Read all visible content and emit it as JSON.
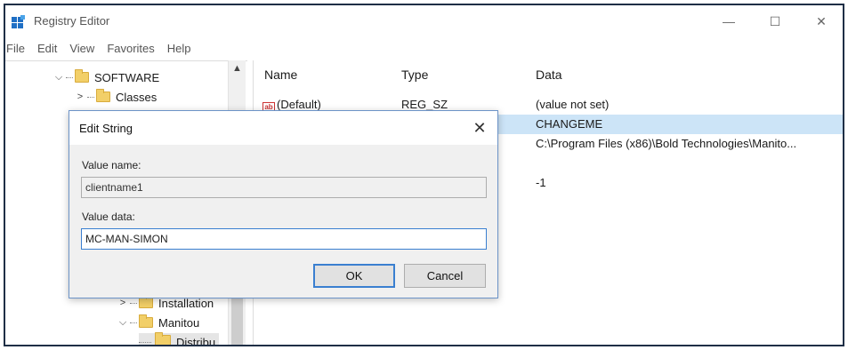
{
  "window": {
    "title": "Registry Editor",
    "controls": {
      "minimize": "—",
      "maximize": "☐",
      "close": "✕"
    }
  },
  "menu": [
    "File",
    "Edit",
    "View",
    "Favorites",
    "Help"
  ],
  "tree": {
    "visible_nodes": [
      {
        "label": "SOFTWARE",
        "expander": "⌵"
      },
      {
        "label": "Classes",
        "expander": ">"
      },
      {
        "label": "Installation",
        "expander": ">"
      },
      {
        "label": "Manitou",
        "expander": "⌵"
      },
      {
        "label": "Distribu",
        "expander": ""
      }
    ],
    "scroll_up": "▲"
  },
  "list": {
    "columns": [
      "Name",
      "Type",
      "Data"
    ],
    "rows": [
      {
        "name": "(Default)",
        "type": "REG_SZ",
        "data": "(value not set)",
        "icon": "ab"
      },
      {
        "name": "",
        "type": "",
        "data": "CHANGEME"
      },
      {
        "name": "",
        "type": "",
        "data": "C:\\Program Files (x86)\\Bold Technologies\\Manito..."
      },
      {
        "name": "",
        "type": "",
        "data": ""
      },
      {
        "name": "",
        "type": "",
        "data": "-1"
      }
    ]
  },
  "dialog": {
    "title": "Edit String",
    "close": "✕",
    "value_name_label": "Value name:",
    "value_name": "clientname1",
    "value_data_label": "Value data:",
    "value_data": "MC-MAN-SIMON",
    "ok_label": "OK",
    "cancel_label": "Cancel"
  },
  "colors": {
    "frame_border": "#1f2f46",
    "selection": "#cce4f7",
    "accent": "#3a7fd0",
    "folder": "#f2cf68"
  }
}
